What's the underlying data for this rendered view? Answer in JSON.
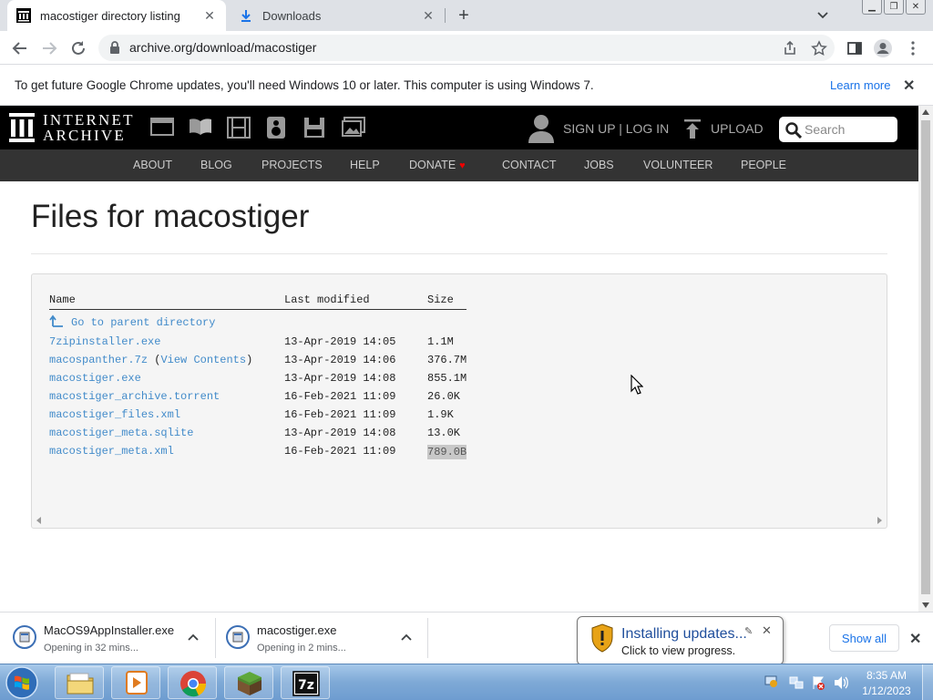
{
  "browser": {
    "tabs": [
      {
        "title": "macostiger directory listing",
        "active": true
      },
      {
        "title": "Downloads",
        "active": false
      }
    ],
    "url": "archive.org/download/macostiger",
    "infobar": {
      "message": "To get future Google Chrome updates, you'll need Windows 10 or later. This computer is using Windows 7.",
      "learn_more": "Learn more"
    }
  },
  "ia_header": {
    "wordmark_line1": "INTERNET",
    "wordmark_line2": "ARCHIVE",
    "signup": "SIGN UP | LOG IN",
    "upload": "UPLOAD",
    "search_placeholder": "Search",
    "nav": [
      "ABOUT",
      "BLOG",
      "PROJECTS",
      "HELP",
      "DONATE",
      "CONTACT",
      "JOBS",
      "VOLUNTEER",
      "PEOPLE"
    ]
  },
  "page": {
    "title": "Files for macostiger",
    "columns": {
      "name": "Name",
      "modified": "Last modified",
      "size": "Size"
    },
    "parent": "Go to parent directory",
    "files": [
      {
        "name": "7zipinstaller.exe",
        "extra": "",
        "modified": "13-Apr-2019 14:05",
        "size": "1.1M"
      },
      {
        "name": "macospanther.7z",
        "extra": "View Contents",
        "modified": "13-Apr-2019 14:06",
        "size": "376.7M"
      },
      {
        "name": "macostiger.exe",
        "extra": "",
        "modified": "13-Apr-2019 14:08",
        "size": "855.1M"
      },
      {
        "name": "macostiger_archive.torrent",
        "extra": "",
        "modified": "16-Feb-2021 11:09",
        "size": "26.0K"
      },
      {
        "name": "macostiger_files.xml",
        "extra": "",
        "modified": "16-Feb-2021 11:09",
        "size": "1.9K"
      },
      {
        "name": "macostiger_meta.sqlite",
        "extra": "",
        "modified": "13-Apr-2019 14:08",
        "size": "13.0K"
      },
      {
        "name": "macostiger_meta.xml",
        "extra": "",
        "modified": "16-Feb-2021 11:09",
        "size": "789.0B"
      }
    ]
  },
  "downloads": {
    "items": [
      {
        "name": "MacOS9AppInstaller.exe",
        "status": "Opening in 32 mins..."
      },
      {
        "name": "macostiger.exe",
        "status": "Opening in 2 mins..."
      }
    ],
    "show_all": "Show all"
  },
  "balloon": {
    "title": "Installing updates...",
    "subtitle": "Click to view progress."
  },
  "taskbar": {
    "time": "8:35 AM",
    "date": "1/12/2023"
  },
  "colors": {
    "link": "#428bca",
    "ia_black": "#000000",
    "ia_nav": "#333333",
    "chrome_accent": "#1a73e8"
  }
}
